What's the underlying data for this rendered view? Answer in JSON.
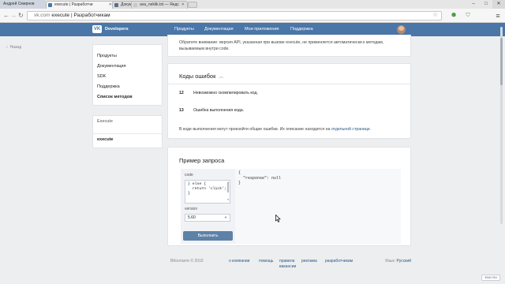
{
  "browser": {
    "user_tab": "Андрей Смирнов",
    "tabs": [
      {
        "label": "execute | Разработчи",
        "favicon_color": "#4a76a8"
      },
      {
        "label": "Документация",
        "favicon_color": "#5a6f8a"
      },
      {
        "label": "ava_neklik.txt — Яндс",
        "favicon_color": "#c8c8c8"
      }
    ],
    "window_buttons": {
      "minimize": "–",
      "maximize": "□",
      "close": "✕"
    },
    "address": {
      "host": "vk.com",
      "separator": " ",
      "title": "execute | Разработчикам"
    },
    "icons": {
      "back": "back-arrow-icon",
      "forward": "forward-arrow-icon",
      "reload": "reload-icon",
      "star": "star-icon",
      "extension": "extension-icon",
      "shield": "shield-icon",
      "menu": "hamburger-menu-icon"
    }
  },
  "header": {
    "logo": "VK",
    "brand": "Developers",
    "nav": [
      "Продукты",
      "Документация",
      "Мои приложения",
      "Поддержка"
    ],
    "accent": "#4a76a8"
  },
  "page": {
    "back_link": "Назад",
    "menu": [
      {
        "label": "Продукты",
        "active": false
      },
      {
        "label": "Документация",
        "active": false
      },
      {
        "label": "SDK",
        "active": false
      },
      {
        "label": "Поддержка",
        "active": false
      },
      {
        "label": "Список методов",
        "active": true
      }
    ],
    "subnav": {
      "title": "Execute",
      "item": "execute"
    },
    "description": "Обратите внимание: версия API, указанная при вызове execute, не применяется автоматически к методам, вызываемым внутри code.",
    "errors": {
      "title": "Коды ошибок",
      "rows": [
        {
          "code": "12",
          "text": "Невозможно скомпилировать код."
        },
        {
          "code": "13",
          "text": "Ошибка выполнения кода."
        }
      ],
      "note_prefix": "В коде выполнения могут произойти общие ошибки. Их описание находится на",
      "note_link": "отдельной странице",
      "note_suffix": "."
    },
    "example": {
      "title": "Пример запроса",
      "code_label": "code",
      "code_lines": [
        "} else {",
        "  return 'click';",
        "}"
      ],
      "version_label": "version",
      "version_value": "5.60",
      "run_button": "Выполнить",
      "response_lines": [
        "{",
        "  \"response\": null",
        "}"
      ]
    },
    "footer": {
      "copyright": "ВКонтакте © 2016",
      "links": [
        "о компании",
        "помощь",
        "правила",
        "реклама",
        "разработчикам",
        "вакансии"
      ],
      "lang_label": "Язык:",
      "lang_value": "Русский"
    },
    "tray_badge": "ENG RU"
  }
}
